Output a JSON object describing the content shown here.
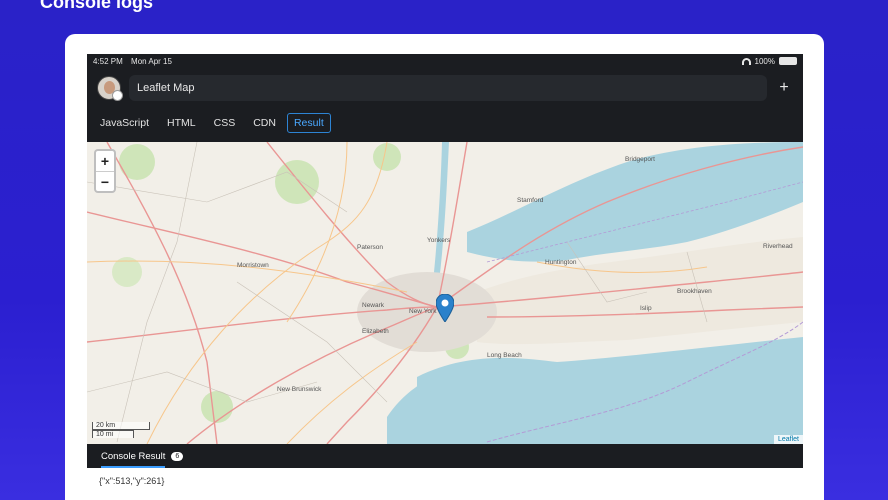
{
  "promo": {
    "title": "Console logs"
  },
  "status_bar": {
    "time": "4:52 PM",
    "date": "Mon Apr 15",
    "battery": "100%"
  },
  "header": {
    "title": "Leaflet Map",
    "add_icon": "plus-icon"
  },
  "tabs": [
    {
      "label": "JavaScript",
      "active": false
    },
    {
      "label": "HTML",
      "active": false
    },
    {
      "label": "CSS",
      "active": false
    },
    {
      "label": "CDN",
      "active": false
    },
    {
      "label": "Result",
      "active": true
    }
  ],
  "map": {
    "zoom_in": "+",
    "zoom_out": "−",
    "scale_km": "20 km",
    "scale_mi": "10 mi",
    "attribution": "Leaflet",
    "marker_icon": "map-pin-icon",
    "labels": [
      {
        "text": "New York"
      },
      {
        "text": "Newark"
      },
      {
        "text": "Paterson"
      },
      {
        "text": "Yonkers"
      },
      {
        "text": "Elizabeth"
      },
      {
        "text": "Stamford"
      },
      {
        "text": "Bridgeport"
      },
      {
        "text": "Huntington"
      },
      {
        "text": "Islip"
      },
      {
        "text": "Riverhead"
      },
      {
        "text": "New Brunswick"
      },
      {
        "text": "Morristown"
      },
      {
        "text": "Brookhaven"
      },
      {
        "text": "Long Beach"
      }
    ]
  },
  "console": {
    "tab_label": "Console Result",
    "count": "6",
    "lines": [
      "{\"x\":513,\"y\":261}"
    ]
  },
  "colors": {
    "background": "#2a22c8",
    "water": "#aad3df",
    "land": "#f2efe8",
    "accent": "#2d84d4",
    "marker": "#2a81cb"
  }
}
